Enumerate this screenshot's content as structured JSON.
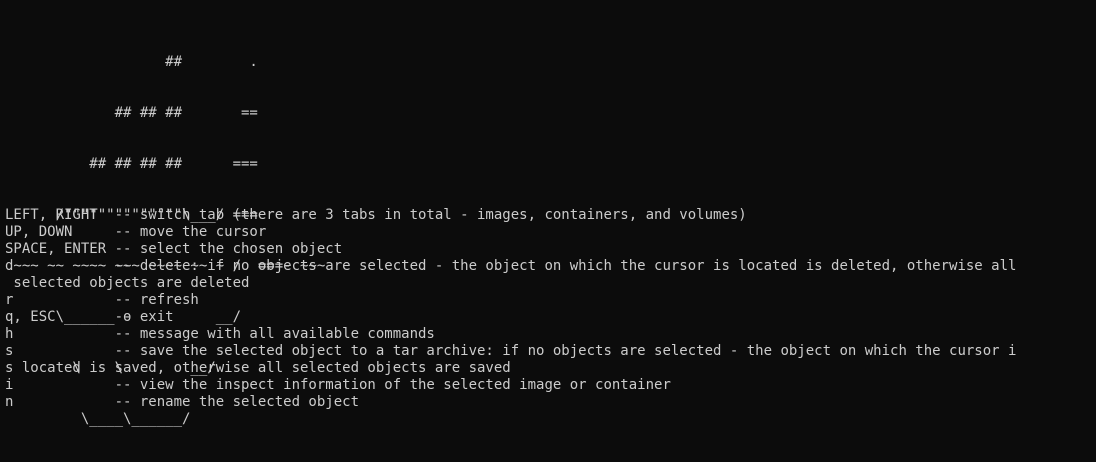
{
  "terminal": {
    "background": "#0c0c0c",
    "foreground": "#cccccc",
    "ascii_logo": [
      "                   ##        .",
      "             ## ## ##       ==",
      "          ## ## ## ##      ===",
      "      /\"\"\"\"\"\"\"\"\"\"\"\"\"\"\\___/ ===",
      " ~~~ ~~ ~~~~ ~~~ ~~~~ ~~ ~ /  ===- ~~~",
      "      \\______ o          __/",
      "        \\    \\        __/",
      "         \\____\\______/"
    ],
    "help_lines": [
      "LEFT, RIGHT  -- switch tab (there are 3 tabs in total - images, containers, and volumes)",
      "UP, DOWN     -- move the cursor",
      "SPACE, ENTER -- select the chosen object",
      "d            -- delete: if no objects are selected - the object on which the cursor is located is deleted, otherwise all",
      " selected objects are deleted",
      "r            -- refresh",
      "q, ESC       -- exit",
      "h            -- message with all available commands",
      "s            -- save the selected object to a tar archive: if no objects are selected - the object on which the cursor i",
      "s located is saved, otherwise all selected objects are saved",
      "i            -- view the inspect information of the selected image or container",
      "n            -- rename the selected object"
    ]
  }
}
